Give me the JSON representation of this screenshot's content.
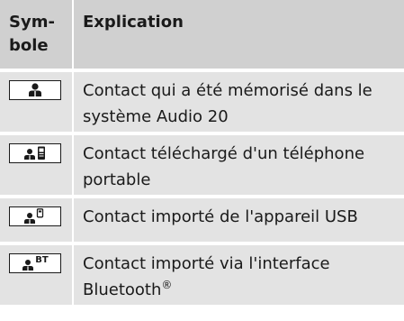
{
  "table": {
    "header": {
      "symbol": "Sym-\nbole",
      "explanation": "Explication"
    },
    "rows": [
      {
        "icon": "contact-person-icon",
        "text": "Contact qui a été mémorisé dans le système Audio 20"
      },
      {
        "icon": "contact-phone-icon",
        "text": "Contact téléchargé d'un téléphone portable"
      },
      {
        "icon": "contact-usb-icon",
        "text": "Contact importé de l'appareil USB"
      },
      {
        "icon": "contact-bluetooth-icon",
        "icon_label": "BT",
        "text": "Contact importé via l'interface Bluetooth",
        "text_suffix": "®"
      }
    ]
  }
}
